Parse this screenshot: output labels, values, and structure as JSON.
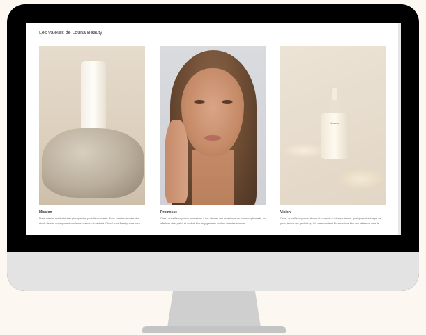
{
  "page": {
    "section_title": "Les valeurs de Louna Beauty"
  },
  "cards": [
    {
      "label": "Mission",
      "text": "Notre mission est d'offrir bien plus que des produits de beauté. Nous souhaitons créer des rituels de soin qui apportent confiance, douceur et sérénité. Chez Louna Beauty, nous nous"
    },
    {
      "label": "Promesse",
      "text": "Chez Louna Beauty, nous promettons à nos clientes une expérience de soin exceptionnelle, qui allie bien-être, plaisir et confort. Nos engagements vont au-delà des formules"
    },
    {
      "label": "Vision",
      "text": "Chez Louna Beauty, nous rêvons d'un monde où chaque femme, quel que soit son type de peau, trouve des produits qui lui correspondent. Nous voulons être une référence dans le"
    }
  ],
  "product": {
    "bottle_brand": "Louna"
  },
  "colors": {
    "background": "#fcf7f1",
    "bezel": "#000000",
    "chin": "#e3e3e3",
    "stand": "#cfcfcf"
  }
}
